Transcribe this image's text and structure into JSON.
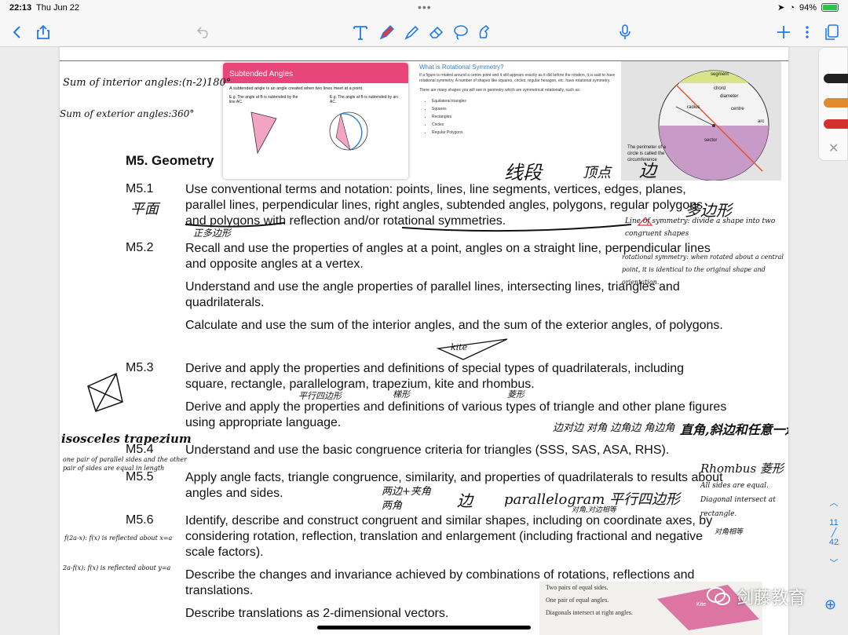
{
  "status": {
    "time": "22:13",
    "date": "Thu Jun 22",
    "battery": "94%"
  },
  "page_indicator": {
    "current": "11",
    "total": "42"
  },
  "watermark": "剑藤教育",
  "doc": {
    "heading": "M5. Geometry",
    "codes": [
      "M5.1",
      "M5.2",
      "M5.3",
      "M5.4",
      "M5.5",
      "M5.6"
    ],
    "items": [
      "Use conventional terms and notation: points, lines, line segments, vertices, edges, planes, parallel lines, perpendicular lines, right angles, subtended angles, polygons, regular polygons and polygons with reflection and/or rotational symmetries.",
      "Recall and use the properties of angles at a point, angles on a straight line, perpendicular lines and opposite angles at a vertex.",
      "Understand and use the angle properties of parallel lines, intersecting lines, triangles and quadrilaterals.",
      "Calculate and use the sum of the interior angles, and the sum of the exterior angles, of polygons.",
      "Derive and apply the properties and definitions of special types of quadrilaterals, including square, rectangle, parallelogram, trapezium, kite and rhombus.",
      "Derive and apply the properties and definitions of various types of triangle and other plane figures using appropriate language.",
      "Understand and use the basic congruence criteria for triangles (SSS, SAS, ASA, RHS).",
      "Apply angle facts, triangle congruence, similarity, and properties of quadrilaterals to results about angles and sides.",
      "Identify, describe and construct congruent and similar shapes, including on coordinate axes, by considering rotation, reflection, translation and enlargement (including fractional and negative scale factors).",
      "Describe the changes and invariance achieved by combinations of rotations, reflections and translations.",
      "Describe translations as 2-dimensional vectors."
    ]
  },
  "image_subtended": {
    "title": "Subtended Angles",
    "text": "A subtended angle is an angle created when two lines meet at a point.",
    "left": "E.g. The angle at B is subtended by the line AC.",
    "right": "E.g. The angle at B is subtended by arc AC."
  },
  "image_rotational": {
    "title": "What is Rotational Symmetry?",
    "p1": "If a figure is rotated around a centre point and it still appears exactly as it did before the rotation, it is said to have rotational symmetry. A number of shapes like squares, circles, regular hexagon, etc. have rotational symmetry.",
    "p2": "There are many shapes you will see in geometry which are symmetrical rotationally, such as:",
    "list": [
      "Equilateral triangles",
      "Squares",
      "Rectangles",
      "Circles",
      "Regular Polygons"
    ]
  },
  "image_circle": {
    "labels": [
      "segment",
      "chord",
      "diameter",
      "radius",
      "centre",
      "arc",
      "sector"
    ],
    "caption": "The perimeter of a circle is called the circumference"
  },
  "image_kite": {
    "lines": [
      "Two pairs of equal sides.",
      "One pair of equal angles.",
      "Diagonals intersect at right angles."
    ],
    "label": "Kite"
  },
  "handwriting": {
    "sum_interior": "Sum of interior angles:(n-2)180°",
    "sum_exterior": "Sum of exterior angles:360°",
    "line_segment_cn": "线段",
    "vertex_cn": "顶点",
    "edge_cn": "边",
    "plane_cn": "平面",
    "polygon_cn": "多边形",
    "regular_polygon_cn": "正多边形",
    "line_symmetry": "Line of symmetry: divide a shape into two congruent shapes",
    "rotational": "rotational symmetry: when rotated about a central point, it is identical to the original shape and orientation.",
    "kite": "kite",
    "parallelogram_cn": "平行四边形",
    "trapezium_cn": "梯形",
    "rhombus_cn": "菱形",
    "isosceles": "isosceles trapezium",
    "iso_desc": "one pair of parallel sides and the other pair of sides are equal in length",
    "edge_angle": "边对边 对角 边角边 角边角",
    "rhs": "直角,斜边和任意一边",
    "rhombus": "Rhombus 菱形",
    "rhombus_desc": "All sides are equal. Diagonal intersect at rectangle.",
    "rhombus_desc_cn": "对角相等",
    "angle_pair": "两边+夹角 两角",
    "edge2": "边",
    "parallelogram": "parallelogram 平行四边形",
    "parallelogram_cn2": "对角,对边相等",
    "reflect1": "f(2a-x): f(x) is reflected about x=a",
    "reflect2": "2a-f(x): f(x) is reflected about y=a"
  }
}
